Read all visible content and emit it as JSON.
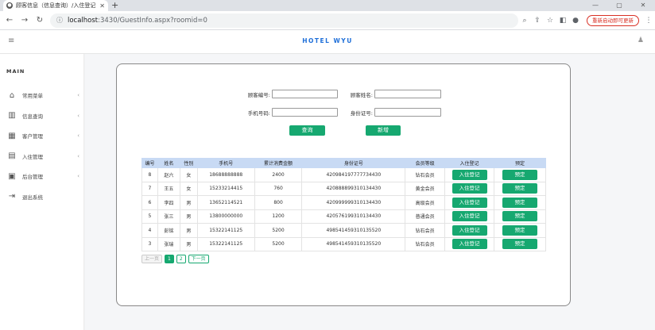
{
  "browser": {
    "tab_title": "顾客信息（信息查询）/入住登记",
    "url_host": "localhost",
    "url_path": ":3430/GuestInfo.aspx?roomid=0",
    "restart_label": "重新启动即可更新"
  },
  "app": {
    "brand": "HOTEL WYU"
  },
  "sidebar": {
    "title": "MAIN",
    "items": [
      {
        "label": "常用菜单",
        "icon": "home-icon",
        "glyph": "⌂",
        "has_submenu": true
      },
      {
        "label": "信息查询",
        "icon": "bar-chart-icon",
        "glyph": "▥",
        "has_submenu": true
      },
      {
        "label": "客户管理",
        "icon": "calendar-icon",
        "glyph": "▦",
        "has_submenu": true
      },
      {
        "label": "入住管理",
        "icon": "clipboard-icon",
        "glyph": "▤",
        "has_submenu": true
      },
      {
        "label": "后台管理",
        "icon": "grid-icon",
        "glyph": "▣",
        "has_submenu": true
      },
      {
        "label": "退出系统",
        "icon": "logout-icon",
        "glyph": "⇥",
        "has_submenu": false
      }
    ]
  },
  "search": {
    "guest_id_label": "顾客编号:",
    "guest_name_label": "顾客姓名:",
    "phone_label": "手机号码:",
    "id_card_label": "身份证号:",
    "search_button": "查询",
    "add_button": "新增"
  },
  "table": {
    "headers": [
      "编号",
      "姓名",
      "性别",
      "手机号",
      "累计消费金额",
      "身份证号",
      "会员等级",
      "入住登记",
      "预定"
    ],
    "checkin_label": "入住登记",
    "reserve_label": "预定",
    "rows": [
      {
        "id": "8",
        "name": "赵六",
        "gender": "女",
        "phone": "18688888888",
        "total": "2400",
        "id_card": "420984197777734430",
        "level": "钻石会员"
      },
      {
        "id": "7",
        "name": "王五",
        "gender": "女",
        "phone": "15233214415",
        "total": "760",
        "id_card": "420888899310134430",
        "level": "黄金会员"
      },
      {
        "id": "6",
        "name": "李四",
        "gender": "男",
        "phone": "13652114521",
        "total": "800",
        "id_card": "420999999310134430",
        "level": "高级会员"
      },
      {
        "id": "5",
        "name": "张三",
        "gender": "男",
        "phone": "13800000000",
        "total": "1200",
        "id_card": "420576199310134430",
        "level": "普通会员"
      },
      {
        "id": "4",
        "name": "彭铭",
        "gender": "男",
        "phone": "15322141125",
        "total": "5200",
        "id_card": "498541459310135520",
        "level": "钻石会员"
      },
      {
        "id": "3",
        "name": "张瑞",
        "gender": "男",
        "phone": "15322141125",
        "total": "5200",
        "id_card": "498541459310135520",
        "level": "钻石会员"
      }
    ]
  },
  "pager": {
    "prev": "上一页",
    "pages": [
      "1",
      "2"
    ],
    "current": "1",
    "next": "下一页"
  },
  "colors": {
    "accent": "#16a870",
    "brand": "#1e6fd9",
    "table_header": "#c8daf4"
  }
}
